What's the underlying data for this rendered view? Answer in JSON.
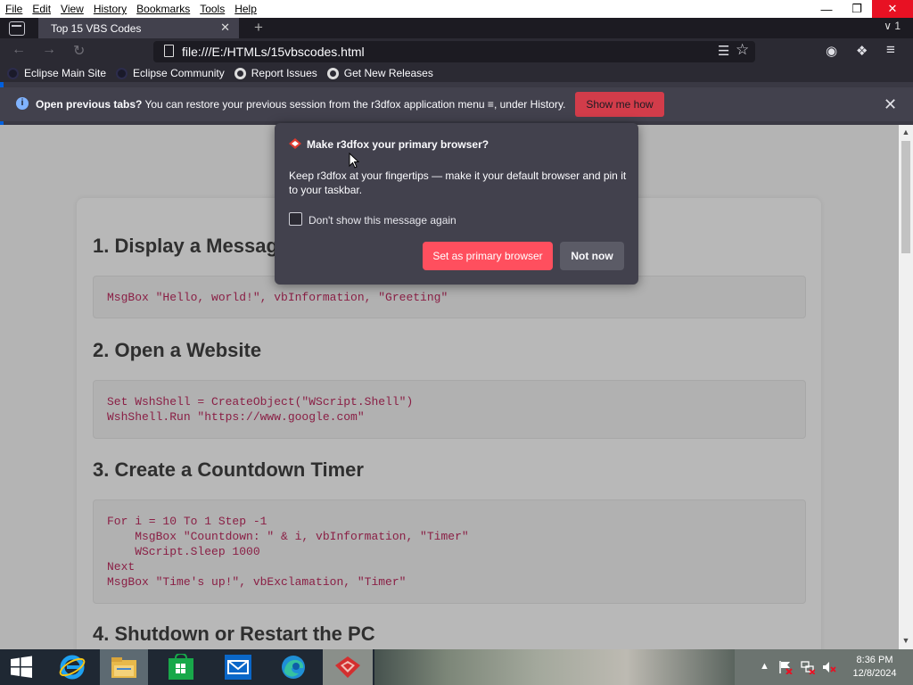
{
  "menubar": {
    "items": [
      "File",
      "Edit",
      "View",
      "History",
      "Bookmarks",
      "Tools",
      "Help"
    ]
  },
  "window_controls": {
    "minimize": "—",
    "restore": "❐",
    "close": "✕"
  },
  "tab": {
    "title": "Top 15 VBS Codes",
    "close": "✕",
    "new_tab": "+",
    "list_all": "∨ 1"
  },
  "nav": {
    "back": "←",
    "forward": "→",
    "reload": "↻",
    "url": "file:///E:/HTMLs/15vbscodes.html",
    "reader": "☰",
    "bookmark_star": "☆",
    "account": "◉",
    "extensions": "❖",
    "menu": "≡"
  },
  "bookmarks": [
    {
      "label": "Eclipse Main Site",
      "icon": "eclipse-icon"
    },
    {
      "label": "Eclipse Community",
      "icon": "eclipse-icon"
    },
    {
      "label": "Report Issues",
      "icon": "github-icon"
    },
    {
      "label": "Get New Releases",
      "icon": "github-icon"
    }
  ],
  "notification": {
    "lead": "Open previous tabs?",
    "text": " You can restore your previous session from the r3dfox application menu ",
    "menu_glyph": "≡",
    "tail": ", under History.",
    "button": "Show me how",
    "close": "✕"
  },
  "page": {
    "sections": [
      {
        "heading": "1. Display a Message Box",
        "code": "MsgBox \"Hello, world!\", vbInformation, \"Greeting\""
      },
      {
        "heading": "2. Open a Website",
        "code": "Set WshShell = CreateObject(\"WScript.Shell\")\nWshShell.Run \"https://www.google.com\""
      },
      {
        "heading": "3. Create a Countdown Timer",
        "code": "For i = 10 To 1 Step -1\n    MsgBox \"Countdown: \" & i, vbInformation, \"Timer\"\n    WScript.Sleep 1000\nNext\nMsgBox \"Time's up!\", vbExclamation, \"Timer\""
      },
      {
        "heading": "4. Shutdown or Restart the PC",
        "code": ""
      }
    ]
  },
  "popup": {
    "title": "Make r3dfox your primary browser?",
    "message": "Keep r3dfox at your fingertips — make it your default browser and pin it to your taskbar.",
    "checkbox_label": "Don't show this message again",
    "checkbox_checked": false,
    "primary_button": "Set as primary browser",
    "secondary_button": "Not now"
  },
  "taskbar": {
    "apps": [
      "start-icon",
      "internet-explorer-icon",
      "file-explorer-icon",
      "store-icon",
      "mail-icon",
      "edge-icon",
      "r3dfox-icon"
    ],
    "tray_up": "▲",
    "time": "8:36 PM",
    "date": "12/8/2024"
  },
  "colors": {
    "accent": "#ff4f5e",
    "notification_button": "#d23c4a",
    "code_text": "#8a1f45",
    "chrome_dark": "#2b2a33"
  }
}
